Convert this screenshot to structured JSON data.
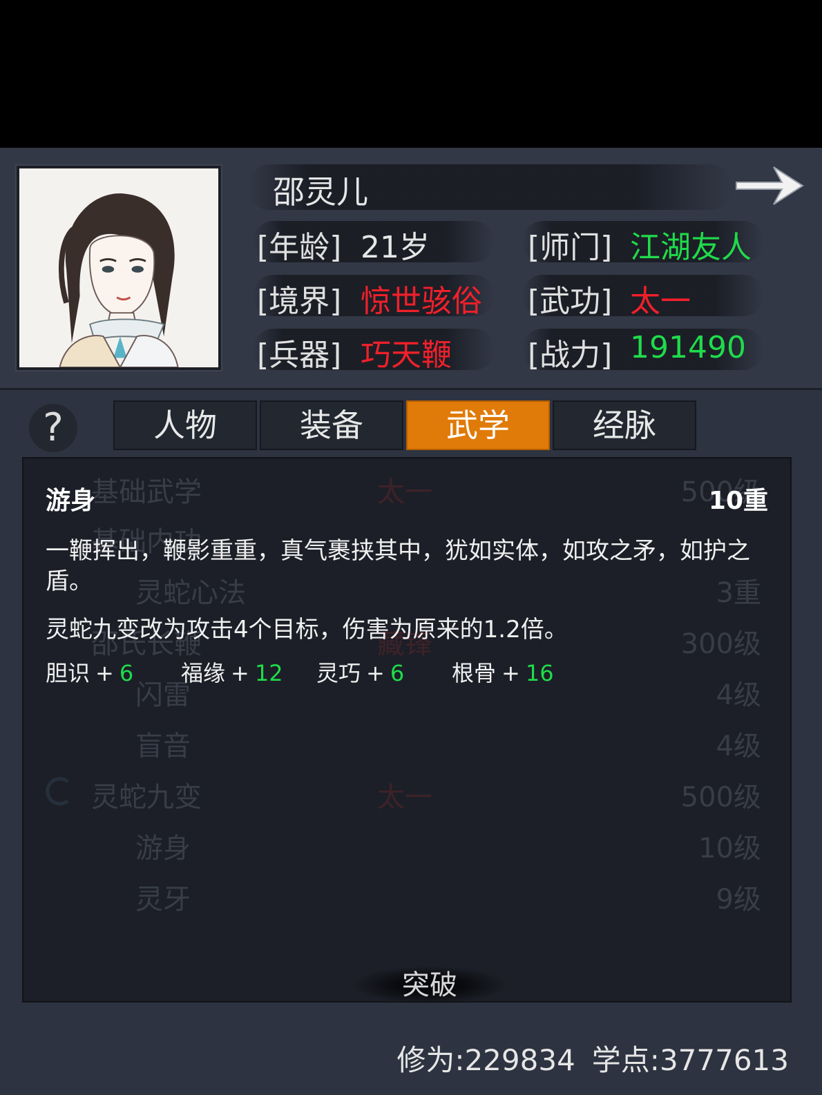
{
  "character": {
    "name": "邵灵儿",
    "stats": {
      "age_label": "[年龄]",
      "age": "21岁",
      "sect_label": "[师门]",
      "sect": "江湖友人",
      "realm_label": "[境界]",
      "realm": "惊世骇俗",
      "martial_label": "[武功]",
      "martial": "太一",
      "weapon_label": "[兵器]",
      "weapon": "巧天鞭",
      "power_label": "[战力]",
      "power": "191490"
    }
  },
  "help_icon": "?",
  "tabs": [
    {
      "label": "人物",
      "active": false
    },
    {
      "label": "装备",
      "active": false
    },
    {
      "label": "武学",
      "active": true
    },
    {
      "label": "经脉",
      "active": false
    }
  ],
  "background_list": [
    {
      "name": "基础武学",
      "school": "太一",
      "level": "500级"
    },
    {
      "name": "基础内功",
      "school": "",
      "level": ""
    },
    {
      "name": "灵蛇心法",
      "school": "",
      "level": "3重"
    },
    {
      "name": "邵氏长鞭",
      "school": "藏锋",
      "level": "300级"
    },
    {
      "name": "闪雷",
      "school": "",
      "level": "4级"
    },
    {
      "name": "盲音",
      "school": "",
      "level": "4级"
    },
    {
      "name": "灵蛇九变",
      "school": "太一",
      "level": "500级"
    },
    {
      "name": "游身",
      "school": "",
      "level": "10级"
    },
    {
      "name": "灵牙",
      "school": "",
      "level": "9级"
    }
  ],
  "tooltip": {
    "title": "游身",
    "level": "10重",
    "description": "一鞭挥出，鞭影重重，真气裹挟其中，犹如实体，如攻之矛，如护之盾。",
    "effect": "灵蛇九变改为攻击4个目标，伤害为原来的1.2倍。",
    "attributes": [
      {
        "name": "胆识",
        "value": "6"
      },
      {
        "name": "福缘",
        "value": "12"
      },
      {
        "name": "灵巧",
        "value": "6"
      },
      {
        "name": "根骨",
        "value": "16"
      }
    ]
  },
  "break_button": "突破",
  "footer": {
    "cultivation": "修为:229834",
    "study_points": "学点:3777613"
  },
  "colors": {
    "active_tab": "#e07a08",
    "green_value": "#1fdc4a",
    "red_value": "#f0202a"
  }
}
